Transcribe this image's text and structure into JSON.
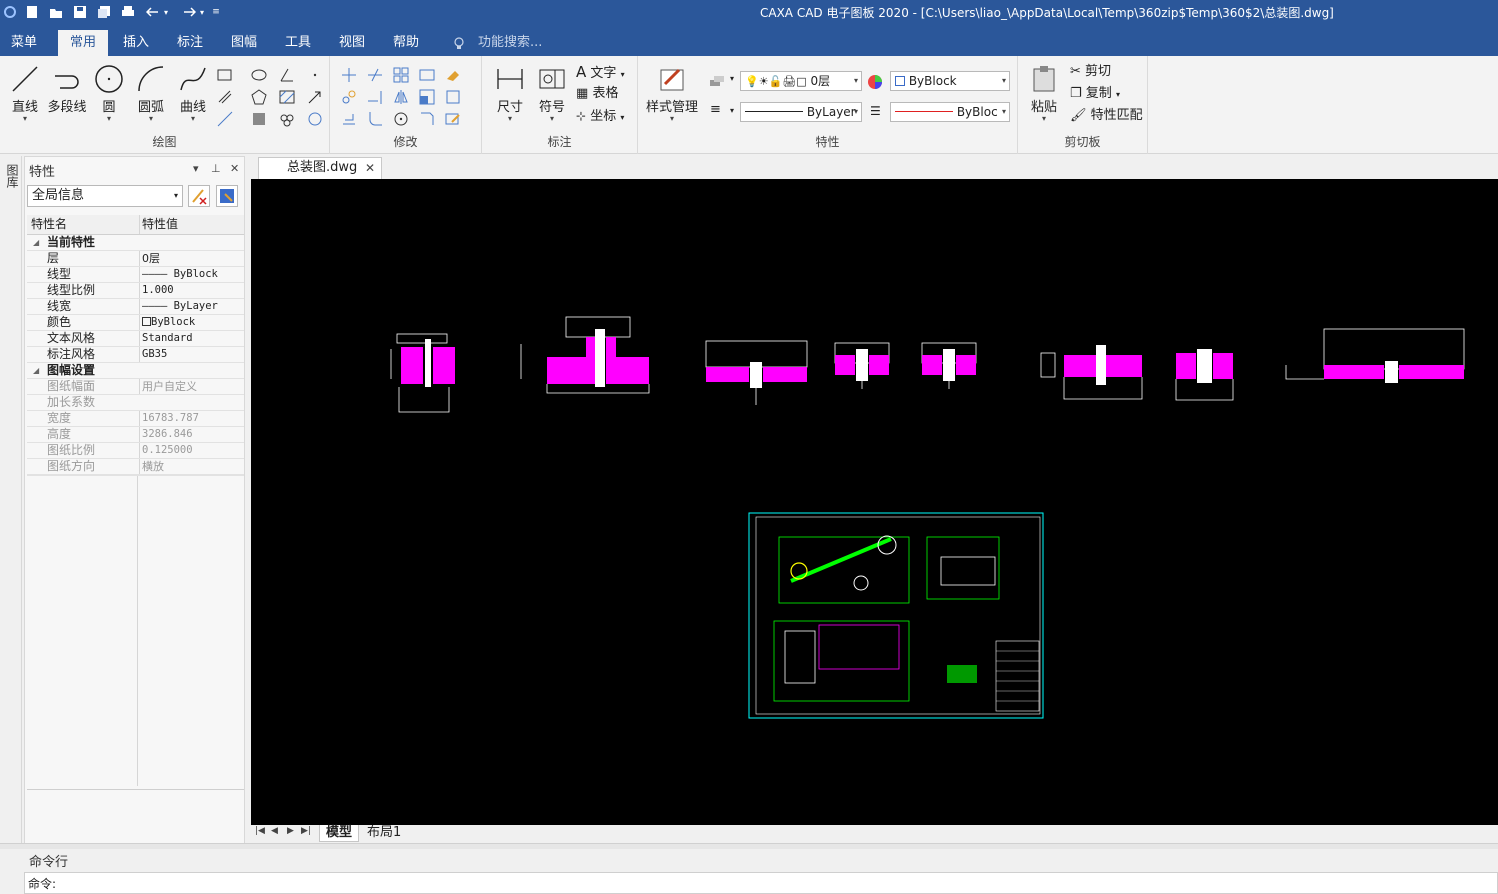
{
  "window": {
    "title": "CAXA CAD 电子图板 2020 - [C:\\Users\\liao_\\AppData\\Local\\Temp\\360zip$Temp\\360$2\\总装图.dwg]"
  },
  "menu_tabs": [
    "菜单",
    "常用",
    "插入",
    "标注",
    "图幅",
    "工具",
    "视图",
    "帮助"
  ],
  "active_menu_tab": "常用",
  "search": {
    "placeholder": "功能搜索..."
  },
  "ribbon": {
    "draw": {
      "group_label": "绘图",
      "line": "直线",
      "polyline": "多段线",
      "circle": "圆",
      "arc": "圆弧",
      "curve": "曲线"
    },
    "modify": {
      "group_label": "修改"
    },
    "annotate": {
      "group_label": "标注",
      "dimension": "尺寸",
      "symbol": "符号",
      "text": "文字",
      "table": "表格",
      "coordinate": "坐标"
    },
    "properties": {
      "group_label": "特性",
      "style_manager": "样式管理",
      "layer_value": "0层",
      "color_value": "ByBlock",
      "linetype_value": "ByLayer",
      "lineweight_value": "ByBloc"
    },
    "clipboard": {
      "group_label": "剪切板",
      "paste": "粘贴",
      "cut": "剪切",
      "copy": "复制",
      "match_props": "特性匹配"
    }
  },
  "side_strip": {
    "label": "图库"
  },
  "properties_panel": {
    "title": "特性",
    "filter_value": "全局信息",
    "col_name": "特性名",
    "col_value": "特性值",
    "current_section": "当前特性",
    "current_rows": [
      {
        "name": "层",
        "value": "0层"
      },
      {
        "name": "线型",
        "value": "———— ByBlock"
      },
      {
        "name": "线型比例",
        "value": "1.000"
      },
      {
        "name": "线宽",
        "value": "———— ByLayer"
      },
      {
        "name": "颜色",
        "value": "ByBlock"
      },
      {
        "name": "文本风格",
        "value": "Standard"
      },
      {
        "name": "标注风格",
        "value": "GB35"
      }
    ],
    "sheet_section": "图幅设置",
    "sheet_rows": [
      {
        "name": "图纸幅面",
        "value": "用户自定义"
      },
      {
        "name": "加长系数",
        "value": ""
      },
      {
        "name": "宽度",
        "value": "16783.787"
      },
      {
        "name": "高度",
        "value": "3286.846"
      },
      {
        "name": "图纸比例",
        "value": "0.125000"
      },
      {
        "name": "图纸方向",
        "value": "横放"
      }
    ]
  },
  "document_tab": {
    "name": "总装图.dwg"
  },
  "layout_tabs": [
    "模型",
    "布局1"
  ],
  "command": {
    "title": "命令行",
    "prompt": "命令:"
  },
  "colors": {
    "accent": "#2b579a",
    "canvas_bg": "#000000",
    "drawing_magenta": "#ff00ff",
    "drawing_white": "#ffffff",
    "drawing_green": "#00ff00",
    "drawing_cyan": "#00ffff"
  }
}
